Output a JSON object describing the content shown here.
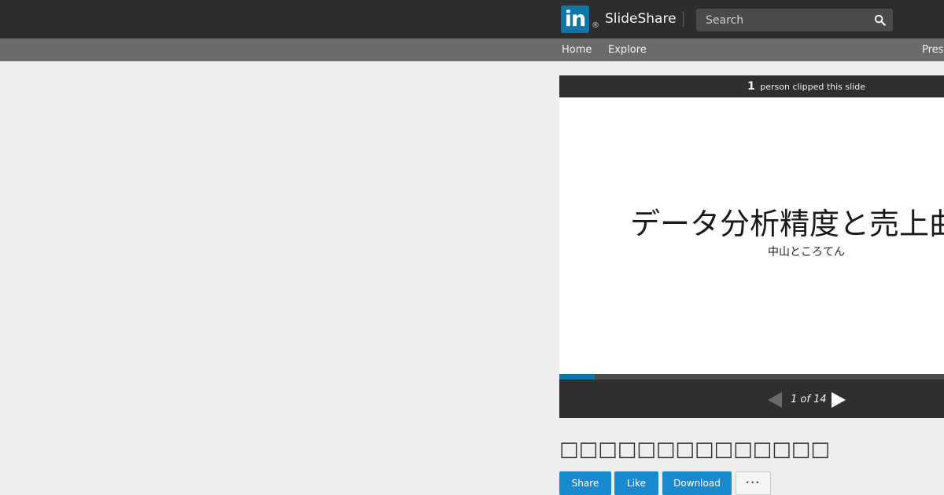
{
  "header": {
    "logo_text": "in",
    "registered_mark": "®",
    "brand": "SlideShare",
    "search": {
      "placeholder": "Search"
    }
  },
  "nav": {
    "items": [
      {
        "label": "Home"
      },
      {
        "label": "Explore"
      },
      {
        "label": "Pres"
      }
    ]
  },
  "player": {
    "clip_count": "1",
    "clip_text": "person clipped this slide",
    "slide": {
      "title": "データ分析精度と売上曲",
      "author": "中山ところてん"
    },
    "progress": 0.0714,
    "page_indicator": "1 of 14"
  },
  "doc": {
    "title": "□□□□□□□□□□□□□□",
    "actions": {
      "share": "Share",
      "like": "Like",
      "download": "Download",
      "more": "···"
    }
  },
  "colors": {
    "topbar": "#2d2d2d",
    "navbar": "#6b6b6b",
    "accent": "#0e76a8",
    "button": "#1a8ad0"
  }
}
